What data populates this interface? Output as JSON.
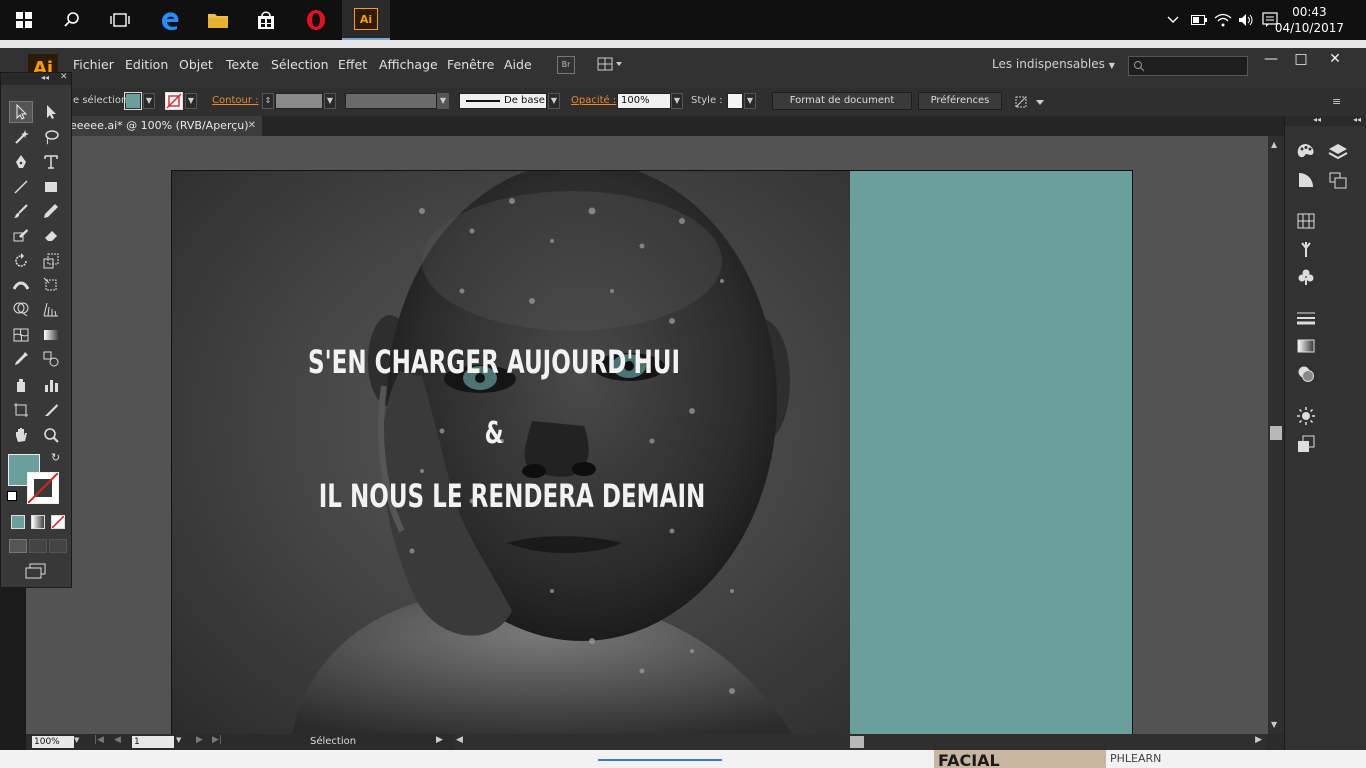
{
  "taskbar": {
    "clock_time": "00:43",
    "clock_date": "04/10/2017"
  },
  "menu": {
    "logo": "Ai",
    "items": [
      "Fichier",
      "Edition",
      "Objet",
      "Texte",
      "Sélection",
      "Effet",
      "Affichage",
      "Fenêtre",
      "Aide"
    ],
    "bridge_label": "Br",
    "workspace": "Les indispensables"
  },
  "controlbar": {
    "selection_label": "e sélection",
    "contour_label": "Contour :",
    "stroke_profile": "De base",
    "opacity_label": "Opacité :",
    "opacity_value": "100%",
    "style_label": "Style :",
    "document_setup_button": "Format de document",
    "preferences_button": "Préférences"
  },
  "document": {
    "tab_title": "eeeee.ai* @ 100% (RVB/Aperçu)"
  },
  "artwork": {
    "line1": "S'EN CHARGER AUJOURD'HUI",
    "line2": "&",
    "line3": "IL NOUS LE RENDERA DEMAIN",
    "teal_color": "#6b9f9c"
  },
  "statusbar": {
    "zoom": "100%",
    "artboard_number": "1",
    "tool_status": "Sélection"
  },
  "colors": {
    "fill": "#6b9f9c",
    "stroke": "none"
  },
  "bottom_ad": {
    "brand": "PHLEARN",
    "big_text": "FACIAL"
  }
}
